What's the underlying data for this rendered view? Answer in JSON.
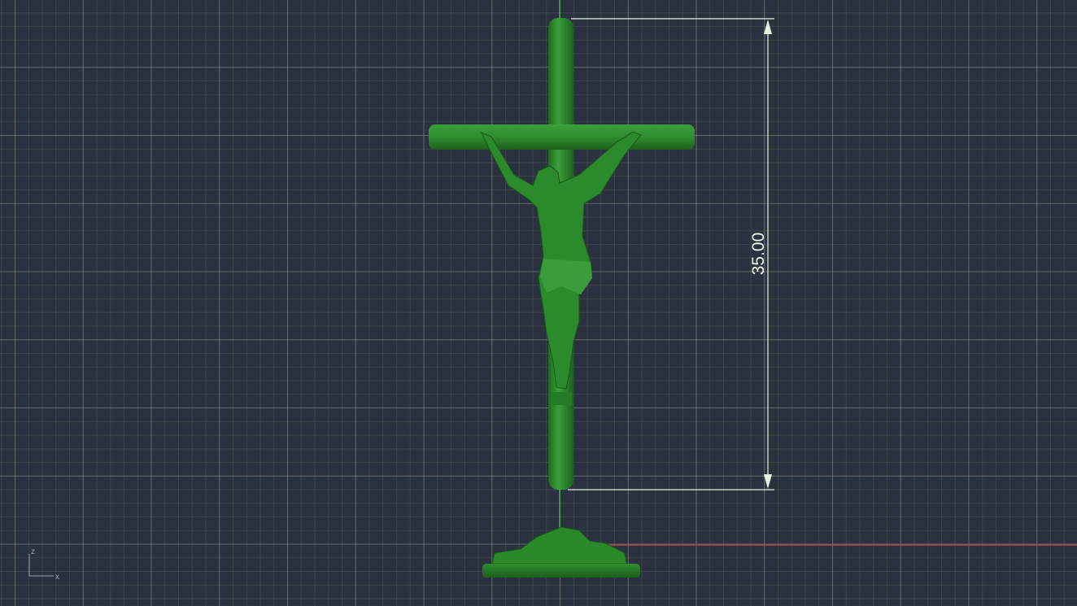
{
  "viewport": {
    "dimension": {
      "value_label": "35.00"
    },
    "axis_indicator": {
      "vertical_label": "z",
      "horizontal_label": "x"
    },
    "colors": {
      "background": "#29323e",
      "model": "#2e8a2e",
      "x_axis": "#b04040",
      "z_axis": "#3fbf3f",
      "dimension": "#e8f0e0"
    }
  }
}
